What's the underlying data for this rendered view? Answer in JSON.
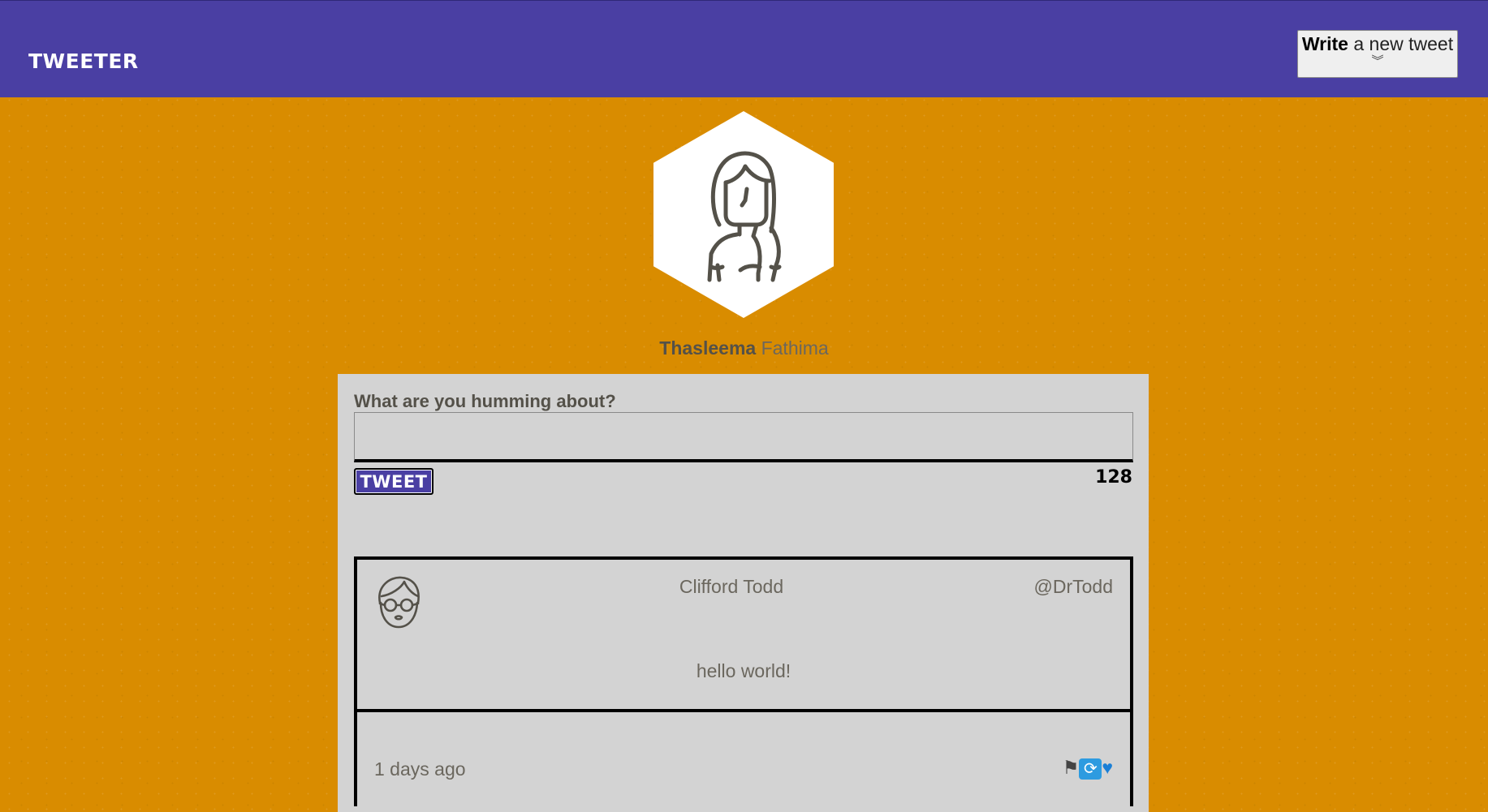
{
  "header": {
    "brand": "TWEETER",
    "write_button": {
      "strong": "Write",
      "rest": " a new tweet",
      "chevron": "︾"
    }
  },
  "profile": {
    "first_name": "Thasleema",
    "last_name": "Fathima",
    "avatar_icon": "woman-avatar-icon"
  },
  "compose": {
    "label": "What are you humming about?",
    "value": "",
    "placeholder": "",
    "submit_label": "TWEET",
    "char_count": "128"
  },
  "tweets": [
    {
      "name": "Clifford Todd",
      "handle": "@DrTodd",
      "text": "hello world!",
      "time": "1 days ago",
      "avatar_icon": "man-glasses-avatar-icon",
      "actions": {
        "flag": "⚑",
        "retweet": "⟳",
        "like": "♥"
      }
    }
  ],
  "colors": {
    "header_bg": "#4a3fa3",
    "page_bg": "#d98c00",
    "panel_bg": "#d3d3d3",
    "text": "#545149"
  }
}
